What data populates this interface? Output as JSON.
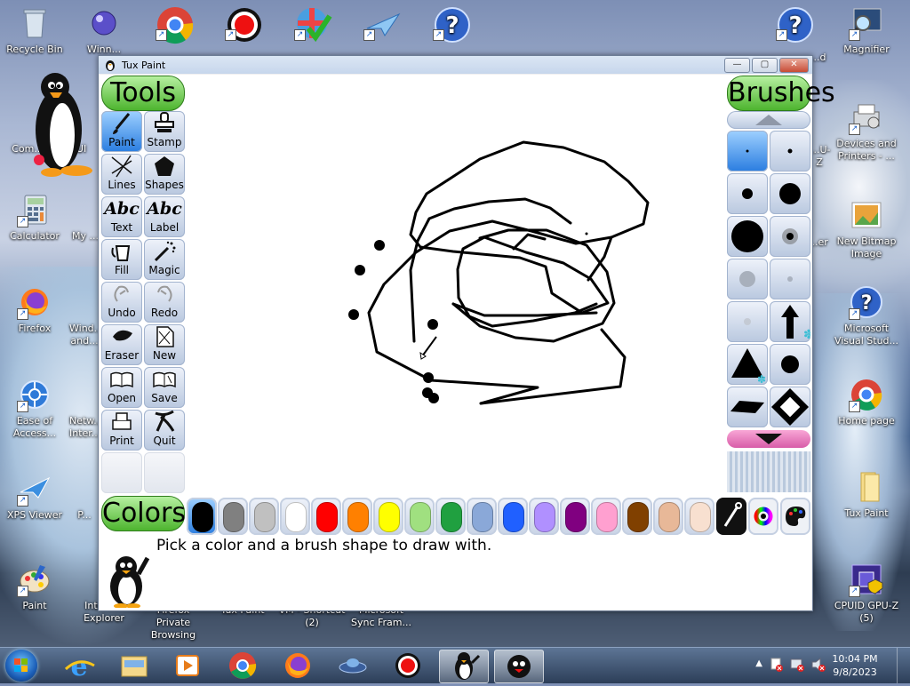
{
  "desktop": {
    "icons_left": [
      {
        "label": "Recycle Bin"
      },
      {
        "label": "Winn..."
      },
      {
        "label": "Com..."
      },
      {
        "label": "...PUI"
      },
      {
        "label": "Calculator"
      },
      {
        "label": "My ..."
      },
      {
        "label": "Firefox"
      },
      {
        "label": "Wind... and..."
      },
      {
        "label": "Ease of Access..."
      },
      {
        "label": "Netw... Inter..."
      },
      {
        "label": "XPS Viewer"
      },
      {
        "label": "P..."
      },
      {
        "label": "Paint"
      },
      {
        "label": "Internet Explorer"
      },
      {
        "label": "Firefox Private Browsing"
      },
      {
        "label": "Tux Paint"
      },
      {
        "label": "VM - Shortcut (2)"
      },
      {
        "label": "Microsoft Sync Fram..."
      }
    ],
    "icons_right": [
      {
        "label": "Magnifier"
      },
      {
        "label": "...d"
      },
      {
        "label": "Devices and Printers - ..."
      },
      {
        "label": "...U-Z"
      },
      {
        "label": "New Bitmap Image"
      },
      {
        "label": "...er"
      },
      {
        "label": "Microsoft Visual Stud..."
      },
      {
        "label": "Home page"
      },
      {
        "label": "Tux Paint"
      },
      {
        "label": "CPUID GPU-Z (5)"
      }
    ]
  },
  "window": {
    "title": "Tux Paint",
    "controls": {
      "minimize": "—",
      "maximize": "▢",
      "close": "✕"
    }
  },
  "tuxpaint": {
    "tools_header": "Tools",
    "brushes_header": "Brushes",
    "colors_header": "Colors",
    "tools": [
      {
        "label": "Paint",
        "icon": "paintbrush-icon"
      },
      {
        "label": "Stamp",
        "icon": "stamp-icon"
      },
      {
        "label": "Lines",
        "icon": "lines-icon"
      },
      {
        "label": "Shapes",
        "icon": "pentagon-icon"
      },
      {
        "label": "Text",
        "icon": "text-icon"
      },
      {
        "label": "Label",
        "icon": "label-icon"
      },
      {
        "label": "Fill",
        "icon": "bucket-icon"
      },
      {
        "label": "Magic",
        "icon": "magic-wand-icon"
      },
      {
        "label": "Undo",
        "icon": "undo-icon"
      },
      {
        "label": "Redo",
        "icon": "redo-icon"
      },
      {
        "label": "Eraser",
        "icon": "eraser-icon"
      },
      {
        "label": "New",
        "icon": "new-page-icon"
      },
      {
        "label": "Open",
        "icon": "open-book-icon"
      },
      {
        "label": "Save",
        "icon": "save-book-icon"
      },
      {
        "label": "Print",
        "icon": "printer-icon"
      },
      {
        "label": "Quit",
        "icon": "quit-icon"
      }
    ],
    "tool_glyphs": {
      "text": "Abc",
      "label": "Abc"
    },
    "selected_tool": "Paint",
    "brushes": [
      {
        "shape": "tiny-dot"
      },
      {
        "shape": "small-dot"
      },
      {
        "shape": "medium-dot"
      },
      {
        "shape": "large-dot"
      },
      {
        "shape": "xlarge-dot"
      },
      {
        "shape": "fuzzy-dot"
      },
      {
        "shape": "soft-grey"
      },
      {
        "shape": "faint"
      },
      {
        "shape": "faint-small"
      },
      {
        "shape": "arrow-up"
      },
      {
        "shape": "triangle"
      },
      {
        "shape": "round"
      },
      {
        "shape": "diamond-flat"
      },
      {
        "shape": "diamond-arrows"
      }
    ],
    "colors": [
      "#000000",
      "#808080",
      "#c0c0c0",
      "#ffffff",
      "#ff0000",
      "#ff8000",
      "#ffff00",
      "#a0e080",
      "#20a040",
      "#8aa8d8",
      "#2060ff",
      "#b090ff",
      "#800080",
      "#ffa0d0",
      "#804000",
      "#e8b898",
      "#f8e0d0"
    ],
    "status_message": "Pick a color and a brush shape to draw with."
  },
  "taskbar": {
    "time": "10:04 PM",
    "date": "9/8/2023",
    "apps": [
      "internet-explorer",
      "file-explorer",
      "media-player",
      "chrome",
      "firefox",
      "ufo-app",
      "record-app",
      "tux-paint",
      "pingus"
    ]
  }
}
